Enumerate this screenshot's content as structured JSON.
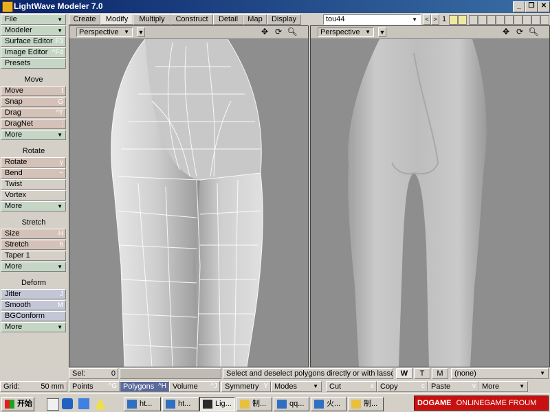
{
  "window": {
    "title": "LightWave Modeler 7.0",
    "min": "_",
    "restore": "❐",
    "close": "✕"
  },
  "toolbar": {
    "file": "File",
    "modeler": "Modeler",
    "surface_editor": "Surface Editor",
    "surface_editor_sc": "F3",
    "image_editor": "Image Editor",
    "image_editor_sc": "^F4",
    "presets": "Presets"
  },
  "sections": {
    "move": {
      "title": "Move",
      "items": [
        [
          "Move",
          "t"
        ],
        [
          "Snap",
          "G"
        ],
        [
          "Drag",
          "^T"
        ],
        [
          "DragNet",
          ";"
        ]
      ],
      "more": "More"
    },
    "rotate": {
      "title": "Rotate",
      "items": [
        [
          "Rotate",
          "y"
        ],
        [
          "Bend",
          "~"
        ],
        [
          "Twist",
          ""
        ],
        [
          "Vortex",
          ""
        ]
      ],
      "more": "More"
    },
    "stretch": {
      "title": "Stretch",
      "items": [
        [
          "Size",
          "H"
        ],
        [
          "Stretch",
          "h"
        ],
        [
          "Taper 1",
          ""
        ]
      ],
      "more": "More"
    },
    "deform": {
      "title": "Deform",
      "items": [
        [
          "Jitter",
          "J"
        ],
        [
          "Smooth",
          "M"
        ],
        [
          "BGConform",
          ""
        ]
      ],
      "more": "More"
    }
  },
  "tabs": [
    "Create",
    "Modify",
    "Multiply",
    "Construct",
    "Detail",
    "Map",
    "Display"
  ],
  "active_tab": "Modify",
  "object_name": "tou44",
  "layer_number": "1",
  "viewports": {
    "left": "Perspective",
    "right": "Perspective"
  },
  "status": {
    "sel_label": "Sel:",
    "sel_value": "0",
    "message": "Select and deselect polygons directly or with lasso.",
    "w": "W",
    "t": "T",
    "m": "M",
    "surface": "(none)"
  },
  "bottom": {
    "grid_label": "Grid:",
    "grid_value": "50 mm",
    "points": "Points",
    "points_sc": "^G",
    "polygons": "Polygons",
    "polygons_sc": "^H",
    "volume": "Volume",
    "volume_sc": "^J",
    "symmetry": "Symmetry",
    "symmetry_sc": "Y",
    "modes": "Modes",
    "cut": "Cut",
    "cut_sc": "x",
    "copy": "Copy",
    "copy_sc": "c",
    "paste": "Paste",
    "paste_sc": "v",
    "more": "More"
  },
  "taskbar": {
    "start": "开始",
    "tasks": [
      "ht...",
      "ht...",
      "Lig...",
      "制...",
      "qq...",
      "火...",
      "制..."
    ],
    "banner_brand": "DOGAME",
    "banner_text": "ONLINEGAME FROUM"
  },
  "colors": {
    "title_start": "#0a246a",
    "title_end": "#3a6ea5",
    "viewport_bg": "#8e8e8e",
    "polygons_active": "#5a6a9a",
    "banner_red": "#c81010"
  }
}
